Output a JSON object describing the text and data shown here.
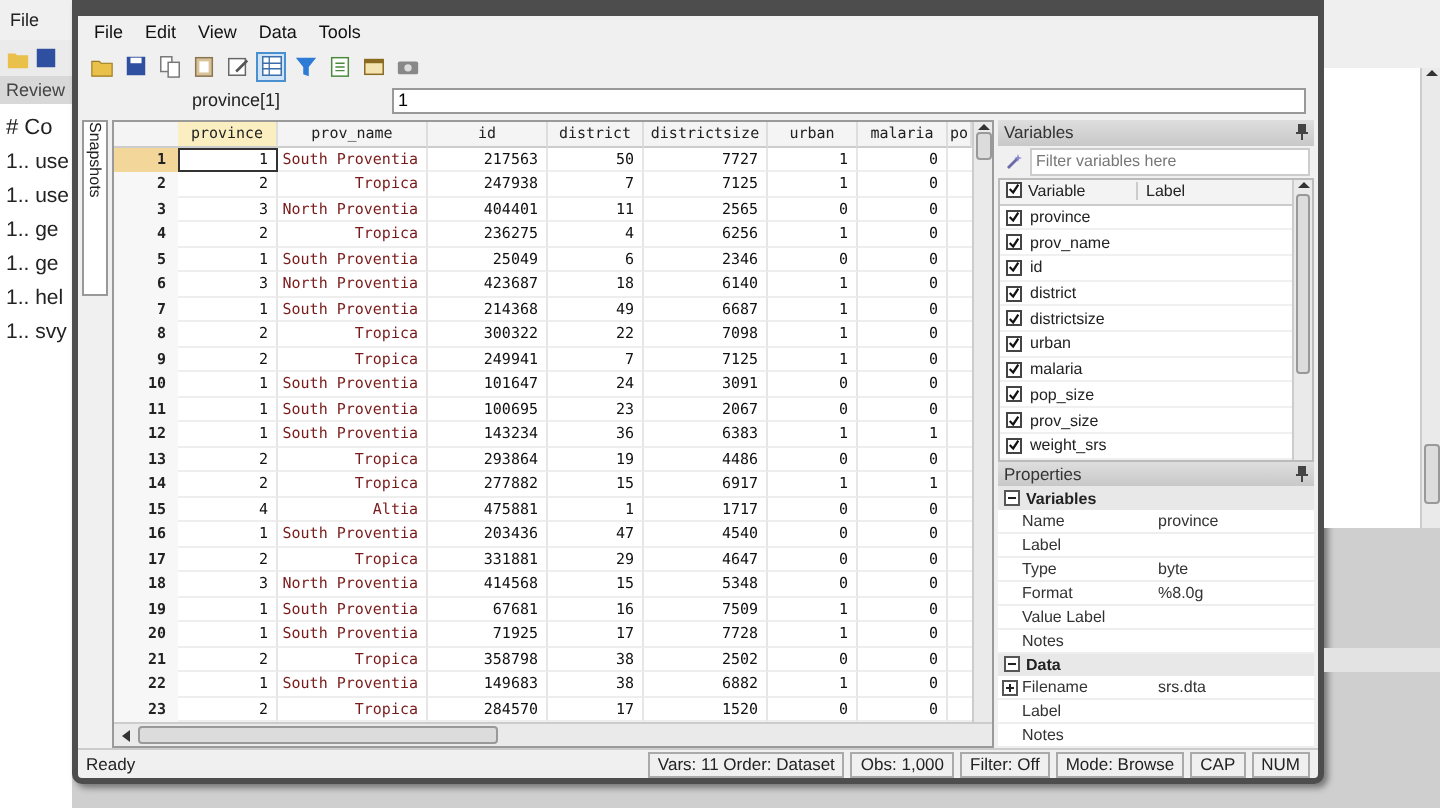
{
  "background_app": {
    "menu": [
      "File"
    ],
    "tab": "Review",
    "history_header": "# Co",
    "history": [
      "1.. use",
      "1.. use",
      "1.. ge",
      "1.. ge",
      "1.. hel",
      "1.. svy"
    ]
  },
  "editor": {
    "menu": [
      "File",
      "Edit",
      "View",
      "Data",
      "Tools"
    ],
    "toolbar": [
      {
        "kind": "open",
        "selected": false
      },
      {
        "kind": "save",
        "selected": false
      },
      {
        "kind": "copy",
        "selected": false
      },
      {
        "kind": "paste",
        "selected": false
      },
      {
        "kind": "edit",
        "selected": false
      },
      {
        "kind": "browse",
        "selected": true
      },
      {
        "kind": "filter",
        "selected": false
      },
      {
        "kind": "variables",
        "selected": false
      },
      {
        "kind": "properties",
        "selected": false
      },
      {
        "kind": "snapshots",
        "selected": false
      }
    ],
    "formula_bar": {
      "cell": "province[1]",
      "value": "1"
    },
    "snapshots_tab": "Snapshots",
    "table": {
      "columns": [
        {
          "label": "province",
          "kind": "number",
          "selected": true
        },
        {
          "label": "prov_name",
          "kind": "string",
          "selected": false
        },
        {
          "label": "id",
          "kind": "number",
          "selected": false
        },
        {
          "label": "district",
          "kind": "number",
          "selected": false
        },
        {
          "label": "districtsize",
          "kind": "number",
          "selected": false
        },
        {
          "label": "urban",
          "kind": "number",
          "selected": false
        },
        {
          "label": "malaria",
          "kind": "number",
          "selected": false
        }
      ],
      "cut_column_header": "po",
      "rows": [
        {
          "number": "1",
          "selected": true,
          "cells": [
            "1",
            "South Proventia",
            "217563",
            "50",
            "7727",
            "1",
            "0"
          ]
        },
        {
          "number": "2",
          "selected": false,
          "cells": [
            "2",
            "Tropica",
            "247938",
            "7",
            "7125",
            "1",
            "0"
          ]
        },
        {
          "number": "3",
          "selected": false,
          "cells": [
            "3",
            "North Proventia",
            "404401",
            "11",
            "2565",
            "0",
            "0"
          ]
        },
        {
          "number": "4",
          "selected": false,
          "cells": [
            "2",
            "Tropica",
            "236275",
            "4",
            "6256",
            "1",
            "0"
          ]
        },
        {
          "number": "5",
          "selected": false,
          "cells": [
            "1",
            "South Proventia",
            "25049",
            "6",
            "2346",
            "0",
            "0"
          ]
        },
        {
          "number": "6",
          "selected": false,
          "cells": [
            "3",
            "North Proventia",
            "423687",
            "18",
            "6140",
            "1",
            "0"
          ]
        },
        {
          "number": "7",
          "selected": false,
          "cells": [
            "1",
            "South Proventia",
            "214368",
            "49",
            "6687",
            "1",
            "0"
          ]
        },
        {
          "number": "8",
          "selected": false,
          "cells": [
            "2",
            "Tropica",
            "300322",
            "22",
            "7098",
            "1",
            "0"
          ]
        },
        {
          "number": "9",
          "selected": false,
          "cells": [
            "2",
            "Tropica",
            "249941",
            "7",
            "7125",
            "1",
            "0"
          ]
        },
        {
          "number": "10",
          "selected": false,
          "cells": [
            "1",
            "South Proventia",
            "101647",
            "24",
            "3091",
            "0",
            "0"
          ]
        },
        {
          "number": "11",
          "selected": false,
          "cells": [
            "1",
            "South Proventia",
            "100695",
            "23",
            "2067",
            "0",
            "0"
          ]
        },
        {
          "number": "12",
          "selected": false,
          "cells": [
            "1",
            "South Proventia",
            "143234",
            "36",
            "6383",
            "1",
            "1"
          ]
        },
        {
          "number": "13",
          "selected": false,
          "cells": [
            "2",
            "Tropica",
            "293864",
            "19",
            "4486",
            "0",
            "0"
          ]
        },
        {
          "number": "14",
          "selected": false,
          "cells": [
            "2",
            "Tropica",
            "277882",
            "15",
            "6917",
            "1",
            "1"
          ]
        },
        {
          "number": "15",
          "selected": false,
          "cells": [
            "4",
            "Altia",
            "475881",
            "1",
            "1717",
            "0",
            "0"
          ]
        },
        {
          "number": "16",
          "selected": false,
          "cells": [
            "1",
            "South Proventia",
            "203436",
            "47",
            "4540",
            "0",
            "0"
          ]
        },
        {
          "number": "17",
          "selected": false,
          "cells": [
            "2",
            "Tropica",
            "331881",
            "29",
            "4647",
            "0",
            "0"
          ]
        },
        {
          "number": "18",
          "selected": false,
          "cells": [
            "3",
            "North Proventia",
            "414568",
            "15",
            "5348",
            "0",
            "0"
          ]
        },
        {
          "number": "19",
          "selected": false,
          "cells": [
            "1",
            "South Proventia",
            "67681",
            "16",
            "7509",
            "1",
            "0"
          ]
        },
        {
          "number": "20",
          "selected": false,
          "cells": [
            "1",
            "South Proventia",
            "71925",
            "17",
            "7728",
            "1",
            "0"
          ]
        },
        {
          "number": "21",
          "selected": false,
          "cells": [
            "2",
            "Tropica",
            "358798",
            "38",
            "2502",
            "0",
            "0"
          ]
        },
        {
          "number": "22",
          "selected": false,
          "cells": [
            "1",
            "South Proventia",
            "149683",
            "38",
            "6882",
            "1",
            "0"
          ]
        },
        {
          "number": "23",
          "selected": false,
          "cells": [
            "2",
            "Tropica",
            "284570",
            "17",
            "1520",
            "0",
            "0"
          ]
        }
      ]
    },
    "variables": {
      "title": "Variables",
      "filter_placeholder": "Filter variables here",
      "columns": [
        "Variable",
        "Label"
      ],
      "all_checked": true,
      "items": [
        {
          "name": "province",
          "checked": true
        },
        {
          "name": "prov_name",
          "checked": true
        },
        {
          "name": "id",
          "checked": true
        },
        {
          "name": "district",
          "checked": true
        },
        {
          "name": "districtsize",
          "checked": true
        },
        {
          "name": "urban",
          "checked": true
        },
        {
          "name": "malaria",
          "checked": true
        },
        {
          "name": "pop_size",
          "checked": true
        },
        {
          "name": "prov_size",
          "checked": true
        },
        {
          "name": "weight_srs",
          "checked": true
        }
      ]
    },
    "properties": {
      "title": "Properties",
      "sections": [
        {
          "title": "Variables",
          "expanded": true,
          "rows": [
            {
              "name": "Name",
              "value": "province"
            },
            {
              "name": "Label"
            },
            {
              "name": "Type",
              "value": "byte"
            },
            {
              "name": "Format",
              "value": "%8.0g"
            },
            {
              "name": "Value Label"
            },
            {
              "name": "Notes"
            }
          ]
        },
        {
          "title": "Data",
          "expanded": true,
          "rows": [
            {
              "name": "Filename",
              "value": "srs.dta",
              "expandable": true
            },
            {
              "name": "Label"
            },
            {
              "name": "Notes"
            }
          ]
        }
      ]
    },
    "status_bar": {
      "status": "Ready",
      "panes": [
        "Vars: 11  Order: Dataset",
        "Obs: 1,000",
        "Filter: Off",
        "Mode: Browse",
        "CAP",
        "NUM"
      ]
    }
  }
}
